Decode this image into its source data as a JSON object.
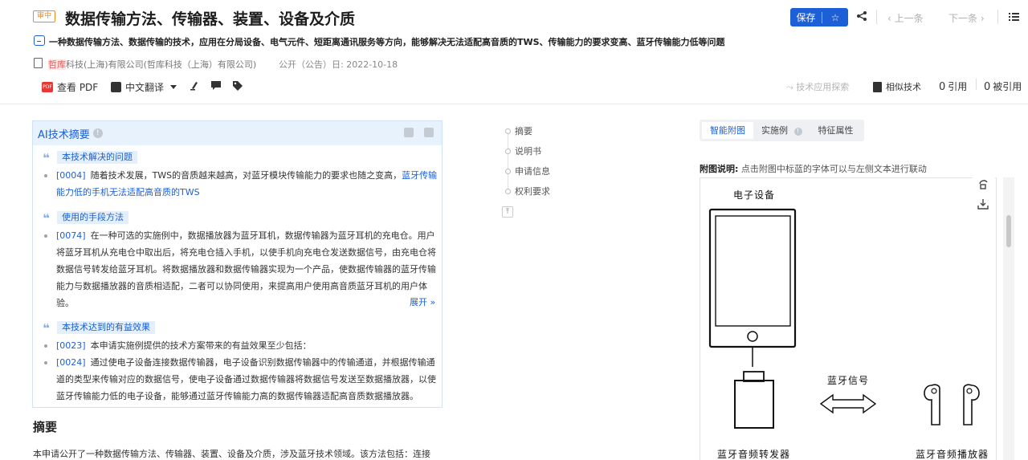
{
  "header": {
    "status_badge": "审中",
    "title": "数据传输方法、传输器、装置、设备及介质",
    "save_label": "保存",
    "prev_label": "上一条",
    "next_label": "下一条",
    "subtitle": "一种数据传输方法、数据传输的技术，应用在分局设备、电气元件、短距离通讯服务等方向，能够解决无法适配高音质的TWS、传输能力的要求变高、蓝牙传输能力低等问题",
    "org_highlight": "哲库",
    "org_rest": "科技(上海)有限公司(哲库科技（上海）有限公司)",
    "pub_date": "公开（公告）日: 2022-10-18",
    "toolbar": {
      "pdf_badge": "PDF",
      "view_pdf": "查看 PDF",
      "translate": "中文翻译",
      "tech_explore": "技术应用探索",
      "similar": "相似技术",
      "cite_count": "0",
      "cite_label": "引用",
      "cited_count": "0",
      "cited_label": "被引用"
    }
  },
  "ai_summary": {
    "title": "AI技术摘要",
    "sections": [
      {
        "label": "本技术解决的问题",
        "ref": "[0004]",
        "text": "随着技术发展，TWS的音质越来越高，对蓝牙模块传输能力的要求也随之变高，",
        "link": "蓝牙传输能力低的手机无法适配高音质的TWS"
      },
      {
        "label": "使用的手段方法",
        "ref": "[0074]",
        "text": "在一种可选的实施例中，数据播放器为蓝牙耳机，数据传输器为蓝牙耳机的充电仓。用户将蓝牙耳机从充电仓中取出后，将充电仓插入手机，以使手机向充电仓发送数据信号，由充电仓将数据信号转发给蓝牙耳机。将数据播放器和数据传输器实现为一个产品，使数据传输器的蓝牙传输能力与数据播放器的音质相适配，二者可以协同使用，来提高用户使用高音质蓝牙耳机的用户体验。",
        "expand": "展开"
      },
      {
        "label": "本技术达到的有益效果",
        "ref": "[0023]",
        "text": "本申请实施例提供的技术方案带来的有益效果至少包括：",
        "ref2": "[0024]",
        "text2": "通过使电子设备连接数据传输器，电子设备识别数据传输器中的传输通道，并根据传输通道的类型来传输对应的数据信号，使电子设备通过数据传输器将数据信号发送至数据播放器，以使蓝牙传输能力低的电子设备，能够通过蓝牙传输能力高的数据传输器适配高音质数据播放器。"
      }
    ]
  },
  "abstract": {
    "heading": "摘要",
    "text": "本申请公开了一种数据传输方法、传输器、装置、设备及介质，涉及蓝牙技术领域。该方法包括：连接"
  },
  "toc": [
    "摘要",
    "说明书",
    "申请信息",
    "权利要求"
  ],
  "right_panel": {
    "tabs": [
      "智能附图",
      "实施例",
      "特征属性"
    ],
    "fig_desc_label": "附图说明:",
    "fig_desc_text": "点击附图中标蓝的字体可以与左侧文本进行联动",
    "figure": {
      "device_label": "电子设备",
      "signal_label": "蓝牙信号",
      "transmitter_label": "蓝牙音频转发器",
      "player_label": "蓝牙音频播放器"
    }
  },
  "colors": {
    "accent": "#1d5fd6",
    "status": "#f08a24",
    "highlight": "#e25c5c"
  }
}
